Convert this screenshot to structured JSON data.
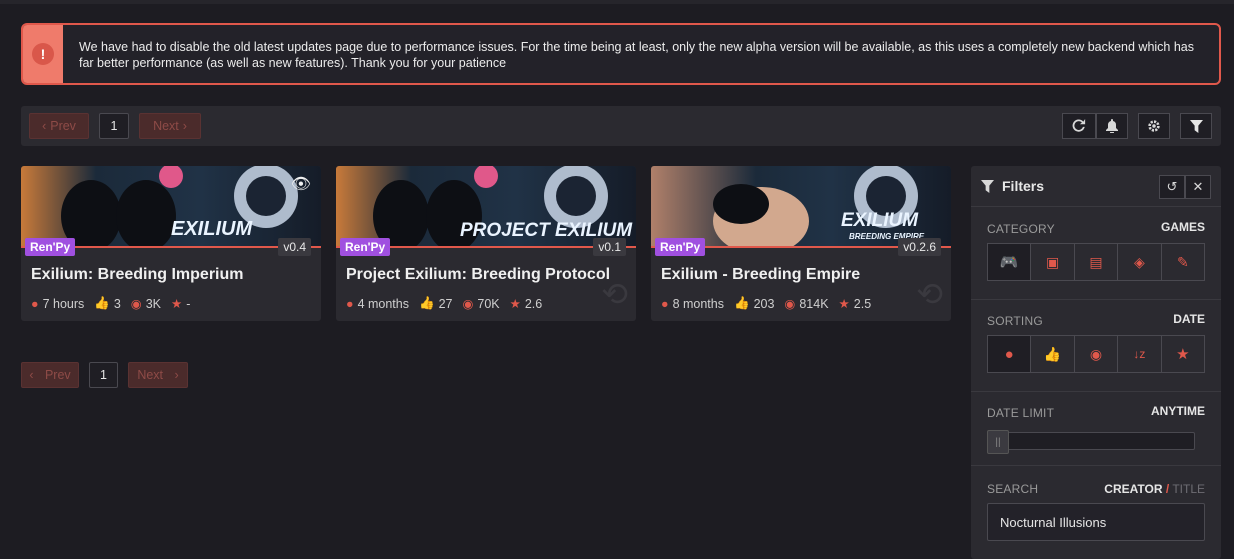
{
  "alert": {
    "icon": "info-icon",
    "message": "We have had to disable the old latest updates page due to performance issues. For the time being at least, only the new alpha version will be available, as this uses a completely new backend which has far better performance (as well as new features). Thank you for your patience"
  },
  "pager": {
    "prev_label": "Prev",
    "next_label": "Next",
    "current_page": "1"
  },
  "toolbar": {
    "icons": [
      "refresh-icon",
      "bell-icon",
      "gear-icon",
      "filter-icon"
    ]
  },
  "cards": [
    {
      "engine": "Ren'Py",
      "version": "v0.4",
      "title": "Exilium: Breeding Imperium",
      "banner_text": "EXILIUM",
      "time": "7 hours",
      "likes": "3",
      "views": "3K",
      "rating": "-"
    },
    {
      "engine": "Ren'Py",
      "version": "v0.1",
      "title": "Project Exilium: Breeding Protocol",
      "banner_text": "PROJECT EXILIUM",
      "time": "4 months",
      "likes": "27",
      "views": "70K",
      "rating": "2.6"
    },
    {
      "engine": "Ren'Py",
      "version": "v0.2.6",
      "title": "Exilium - Breeding Empire",
      "banner_text": "EXILIUM",
      "banner_sub": "BREEDING EMPIRE",
      "time": "8 months",
      "likes": "203",
      "views": "814K",
      "rating": "2.5"
    }
  ],
  "filters": {
    "title": "Filters",
    "category_label": "CATEGORY",
    "category_value": "GAMES",
    "sorting_label": "SORTING",
    "sorting_value": "DATE",
    "date_limit_label": "DATE LIMIT",
    "date_limit_value": "ANYTIME",
    "search_label": "SEARCH",
    "search_mode_active": "CREATOR",
    "search_mode_sep": "/",
    "search_mode_inactive": "TITLE",
    "search_value": "Nocturnal Illusions"
  },
  "colors": {
    "accent": "#e0584b",
    "engine_badge": "#a050e0",
    "background": "#1d1c22",
    "panel": "#2b2a30"
  }
}
